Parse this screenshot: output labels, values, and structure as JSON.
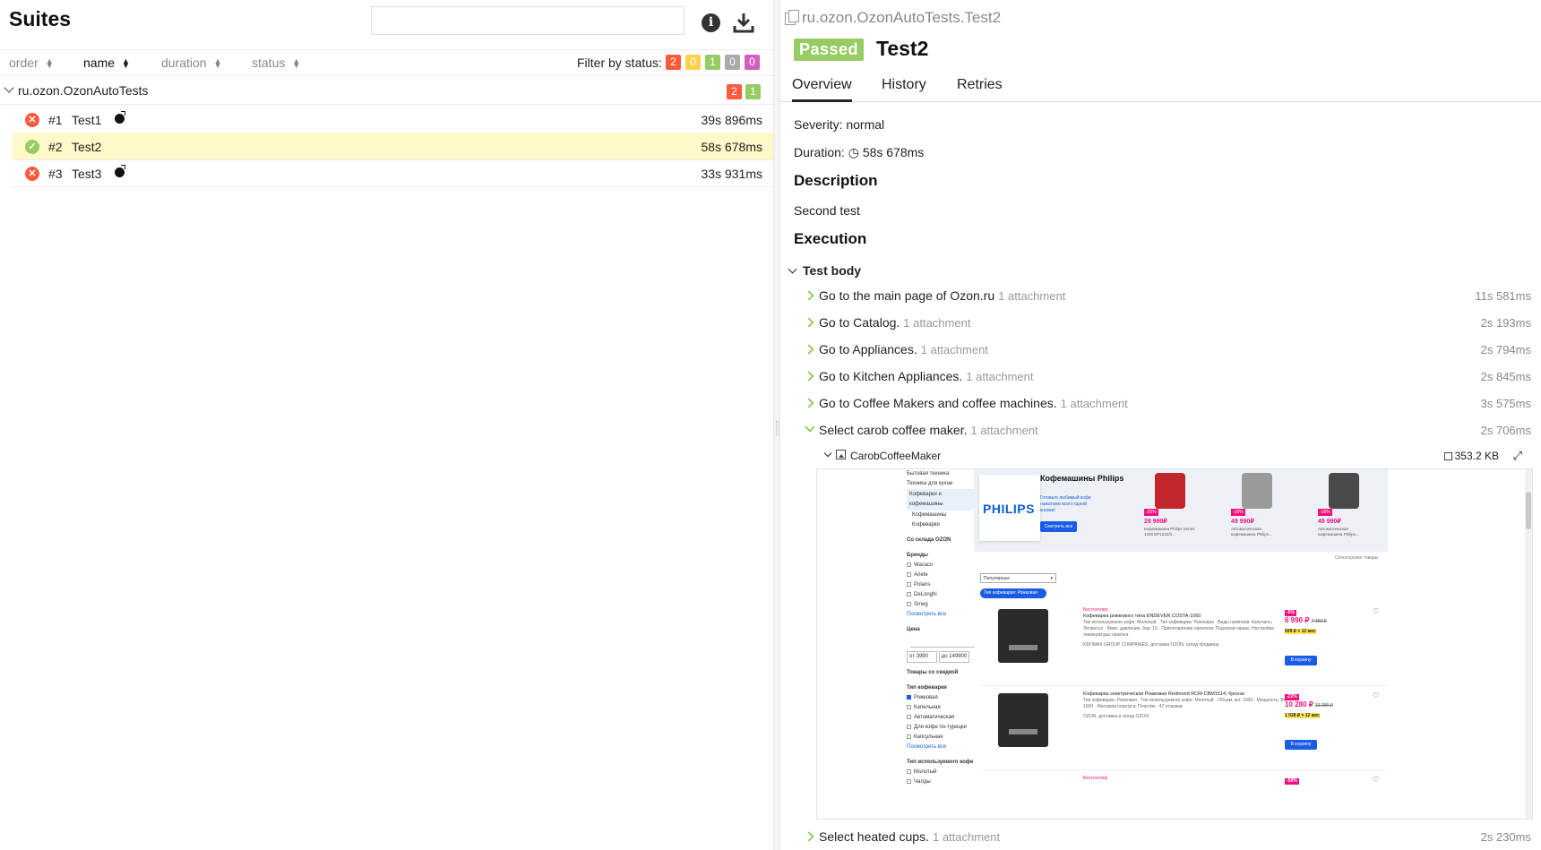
{
  "left": {
    "title": "Suites",
    "search_placeholder": "",
    "columns": [
      {
        "label": "order",
        "active": false
      },
      {
        "label": "name",
        "active": true
      },
      {
        "label": "duration",
        "active": false
      },
      {
        "label": "status",
        "active": false
      }
    ],
    "filter_label": "Filter by status:",
    "filter_badges": [
      {
        "value": "2",
        "color": "#fd5a3e",
        "status": "failed"
      },
      {
        "value": "0",
        "color": "#ffd050",
        "status": "broken"
      },
      {
        "value": "1",
        "color": "#97cc64",
        "status": "passed"
      },
      {
        "value": "0",
        "color": "#aaaaaa",
        "status": "skipped"
      },
      {
        "value": "0",
        "color": "#d35ebe",
        "status": "unknown"
      }
    ],
    "group": {
      "name": "ru.ozon.OzonAutoTests",
      "failed_count": "2",
      "passed_count": "1"
    },
    "tests": [
      {
        "order": "#1",
        "name": "Test1",
        "duration": "39s 896ms",
        "status": "failed",
        "flaky": true,
        "selected": false
      },
      {
        "order": "#2",
        "name": "Test2",
        "duration": "58s 678ms",
        "status": "passed",
        "flaky": false,
        "selected": true
      },
      {
        "order": "#3",
        "name": "Test3",
        "duration": "33s 931ms",
        "status": "failed",
        "flaky": true,
        "selected": false
      }
    ]
  },
  "right": {
    "breadcrumb": "ru.ozon.OzonAutoTests.Test2",
    "status_badge": "Passed",
    "title": "Test2",
    "tabs": [
      "Overview",
      "History",
      "Retries"
    ],
    "severity_label": "Severity:",
    "severity_value": "normal",
    "duration_label": "Duration:",
    "duration_value": "58s 678ms",
    "description_heading": "Description",
    "description_text": "Second test",
    "execution_heading": "Execution",
    "test_body_label": "Test body",
    "steps": [
      {
        "name": "Go to the main page of Ozon.ru",
        "att": "1 attachment",
        "dur": "11s 581ms",
        "open": false
      },
      {
        "name": "Go to Catalog.",
        "att": "1 attachment",
        "dur": "2s 193ms",
        "open": false
      },
      {
        "name": "Go to Appliances.",
        "att": "1 attachment",
        "dur": "2s 794ms",
        "open": false
      },
      {
        "name": "Go to Kitchen Appliances.",
        "att": "1 attachment",
        "dur": "2s 845ms",
        "open": false
      },
      {
        "name": "Go to Coffee Makers and coffee machines.",
        "att": "1 attachment",
        "dur": "3s 575ms",
        "open": false
      },
      {
        "name": "Select carob coffee maker.",
        "att": "1 attachment",
        "dur": "2s 706ms",
        "open": true
      },
      {
        "name": "Select heated cups.",
        "att": "1 attachment",
        "dur": "2s 230ms",
        "open": false
      }
    ],
    "attachment": {
      "name": "CarobCoffeeMaker",
      "size": "353.2 KB"
    }
  },
  "screenshot": {
    "sidebar": {
      "back1": "Бытовая техника",
      "back2": "Техника для кухни",
      "selected": "Кофеварки и кофемашины",
      "sub1": "Кофемашины",
      "sub2": "Кофеварки",
      "warehouse": "Со склада OZON",
      "brands_heading": "Бренды",
      "brands": [
        "Wacaco",
        "Ariete",
        "Polaris",
        "DeLonghi",
        "Smeg"
      ],
      "show_all": "Посмотреть все",
      "price_heading": "Цена",
      "price_from": "от  3990",
      "price_to": "до  149900",
      "discount": "Товары со скидкой",
      "type_heading": "Тип кофеварки",
      "types": [
        "Рожковая",
        "Капельная",
        "Автоматическая",
        "Для кофе по-турецки",
        "Капсульная"
      ],
      "show_all2": "Посмотреть все",
      "coffee_heading": "Тип используемого кофе",
      "coffee": [
        "Молотый",
        "Чалды"
      ]
    },
    "banner": {
      "brand": "PHILIPS",
      "title": "Кофемашины Philips",
      "text": "Готовьте любимый кофе нажатием всего одной кнопки!",
      "button": "Смотреть все",
      "sponsored": "Спонсорские товары",
      "products": [
        {
          "discount": "-25%",
          "price": "29 990₽",
          "desc": "Кофемашина Philips Series 1200 EP1222/0...",
          "color": "#c0262b"
        },
        {
          "discount": "-16%",
          "price": "49 990₽",
          "desc": "Автоматическая кофемашина Philips...",
          "color": "#9a9a9a"
        },
        {
          "discount": "-16%",
          "price": "49 990₽",
          "desc": "Автоматическая кофемашина Philips...",
          "color": "#4a4a4a"
        }
      ]
    },
    "sort_label": "Популярные",
    "chip_label": "Тип кофеварки: Рожковая",
    "products": [
      {
        "tag": "Бестселлер",
        "title": "Кофеварка рожкового типа ENDEVER COSTA-1060",
        "specs": "Тип используемого кофе: Молотый · Тип кофеварки: Рожковая · Виды напитков: Капучино, Эспрессо · Макс. давление, бар: 15 · Приготовление напитков: Подогрев чашек, Настройка температуры напитка",
        "seller": "KROMAX GROUP COMPANIES, доставка OZON, склад продавца",
        "discount": "-6%",
        "price": "6 990 ₽",
        "old": "7 490 ₽",
        "card": "609 ₽ × 12 мес",
        "cart": "В корзину"
      },
      {
        "tag": "",
        "title": "Кофеварка электрическая Рожковая Redmond RCM-CBM1514, бронза",
        "specs": "Тип кофеварки: Рожковая · Тип используемого кофе: Молотый · Объем, мл: 1000 · Мощность, Вт: 1000 · Материал корпуса: Пластик · 47 отзывов",
        "seller": "OZON, доставка и склад OZON",
        "discount": "-22%",
        "price": "10 280 ₽",
        "old": "13 290 ₽",
        "card": "1 028 ₽ × 12 мес",
        "cart": "В корзину"
      },
      {
        "tag": "Бестселлер",
        "title": "",
        "specs": "",
        "seller": "",
        "discount": "-50%",
        "price": "",
        "old": "",
        "card": "",
        "cart": ""
      }
    ]
  }
}
